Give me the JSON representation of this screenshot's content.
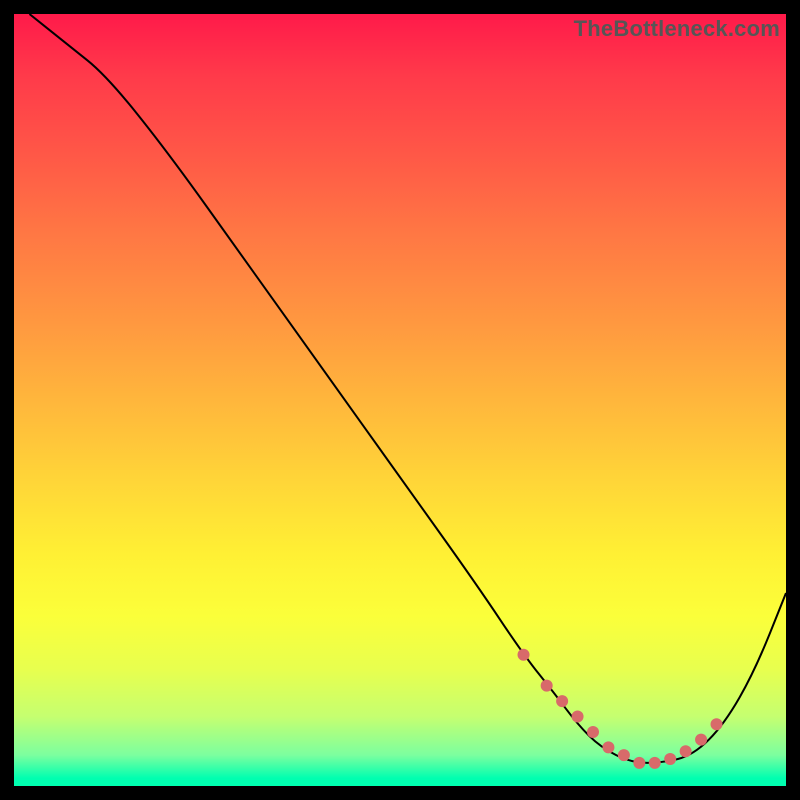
{
  "watermark": "TheBottleneck.com",
  "chart_data": {
    "type": "line",
    "title": "",
    "xlabel": "",
    "ylabel": "",
    "xlim": [
      0,
      100
    ],
    "ylim": [
      0,
      100
    ],
    "grid": false,
    "series": [
      {
        "name": "curve",
        "color": "#000000",
        "stroke_width": 2,
        "x": [
          2,
          7,
          12,
          20,
          30,
          40,
          50,
          60,
          66,
          70,
          73,
          76,
          80,
          84,
          88,
          92,
          96,
          100
        ],
        "y": [
          100,
          96,
          92,
          82,
          68,
          54,
          40,
          26,
          17,
          12,
          8,
          5,
          3,
          3,
          4,
          8,
          15,
          25
        ]
      },
      {
        "name": "highlight-dots",
        "color": "#d86a6a",
        "marker_radius": 6,
        "x": [
          66,
          69,
          71,
          73,
          75,
          77,
          79,
          81,
          83,
          85,
          87,
          89,
          91
        ],
        "y": [
          17,
          13,
          11,
          9,
          7,
          5,
          4,
          3,
          3,
          3.5,
          4.5,
          6,
          8
        ]
      }
    ]
  }
}
